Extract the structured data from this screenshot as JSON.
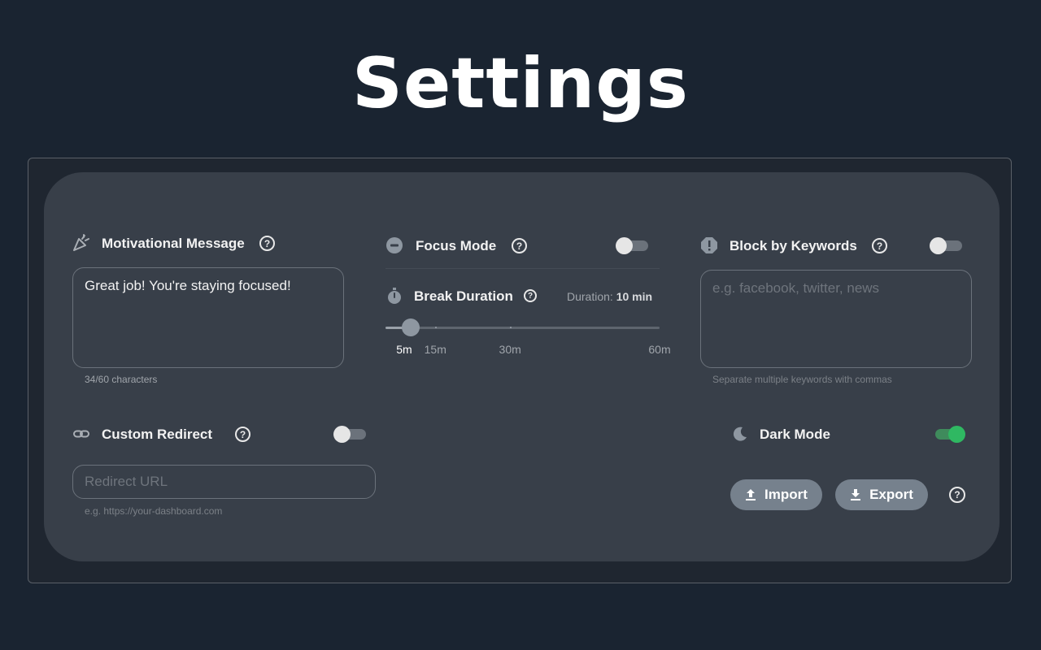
{
  "page": {
    "title": "Settings"
  },
  "motivational": {
    "label": "Motivational Message",
    "value": "Great job! You're staying focused!",
    "counter": "34/60 characters"
  },
  "focus": {
    "label": "Focus Mode",
    "enabled": false
  },
  "break_duration": {
    "label": "Break Duration",
    "duration_prefix": "Duration:",
    "duration_value": "10 min",
    "value_minutes": 10,
    "min_minutes": 5,
    "max_minutes": 60,
    "ticks": [
      {
        "label": "5m",
        "minutes": 5
      },
      {
        "label": "15m",
        "minutes": 15
      },
      {
        "label": "30m",
        "minutes": 30
      },
      {
        "label": "60m",
        "minutes": 60
      }
    ]
  },
  "keywords": {
    "label": "Block by Keywords",
    "enabled": false,
    "placeholder": "e.g. facebook, twitter, news",
    "hint": "Separate multiple keywords with commas"
  },
  "redirect": {
    "label": "Custom Redirect",
    "enabled": false,
    "placeholder": "Redirect URL",
    "hint": "e.g. https://your-dashboard.com"
  },
  "dark_mode": {
    "label": "Dark Mode",
    "enabled": true
  },
  "actions": {
    "import_label": "Import",
    "export_label": "Export"
  },
  "colors": {
    "accent_on": "#2fb862",
    "panel_bg": "#383f49",
    "page_bg": "#1a2431"
  },
  "icons": {
    "motivational": "party-popper-icon",
    "focus": "minus-circle-icon",
    "break": "stopwatch-icon",
    "keywords": "alert-octagon-icon",
    "redirect": "link-icon",
    "dark_mode": "moon-icon",
    "import": "upload-icon",
    "export": "download-icon"
  }
}
